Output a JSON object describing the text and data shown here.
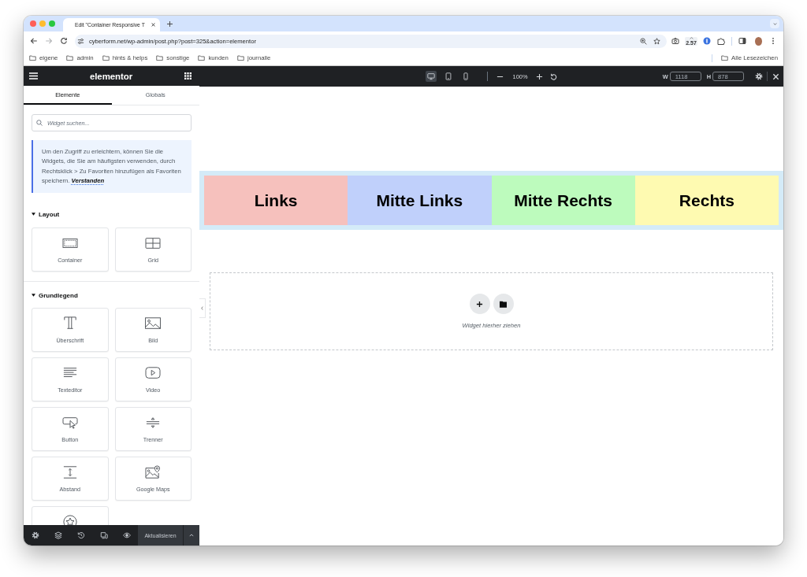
{
  "browser": {
    "tabs": [
      {
        "title": "Edit \"Container Responsive T",
        "selected": true
      }
    ],
    "nav": [
      {
        "kind": "back",
        "disabled": false
      },
      {
        "kind": "forward",
        "disabled": true
      },
      {
        "kind": "reload",
        "disabled": false
      }
    ],
    "url": "cyberform.net/wp-admin/post.php?post=325&action=elementor",
    "extension_badge": "2.57",
    "bookmarks": [
      {
        "label": "eigene"
      },
      {
        "label": "admin"
      },
      {
        "label": "hints & helps"
      },
      {
        "label": "sonstige"
      },
      {
        "label": "kunden"
      },
      {
        "label": "journalle"
      }
    ],
    "all_bookmarks": "Alle Lesezeichen"
  },
  "panel": {
    "logo": "elementor",
    "tabs": [
      {
        "label": "Elemente",
        "selected": true
      },
      {
        "label": "Globals",
        "selected": false
      }
    ],
    "search": {
      "placeholder": "Widget suchen..."
    },
    "notice": {
      "text": "Um den Zugriff zu erleichtern, können Sie die Widgets, die Sie am häufigsten verwenden, durch Rechtsklick > Zu Favoriten hinzufügen als Favoriten speichern.",
      "link": "Verstanden"
    },
    "categories": [
      {
        "title": "Layout",
        "expanded": true,
        "widgets": [
          {
            "kind": "container",
            "label": "Container"
          },
          {
            "kind": "grid",
            "label": "Grid"
          }
        ]
      },
      {
        "title": "Grundlegend",
        "expanded": true,
        "widgets": [
          {
            "kind": "heading",
            "label": "Überschrift"
          },
          {
            "kind": "image",
            "label": "Bild"
          },
          {
            "kind": "text-editor",
            "label": "Texteditor"
          },
          {
            "kind": "video",
            "label": "Video"
          },
          {
            "kind": "button",
            "label": "Button"
          },
          {
            "kind": "divider",
            "label": "Trenner"
          },
          {
            "kind": "spacer",
            "label": "Abstand"
          },
          {
            "kind": "map",
            "label": "Google Maps"
          },
          {
            "kind": "rating"
          }
        ]
      }
    ],
    "footer": {
      "update_button": "Aktualisieren"
    }
  },
  "preview": {
    "devices": [
      {
        "kind": "desktop",
        "selected": true
      },
      {
        "kind": "tablet",
        "selected": false
      },
      {
        "kind": "mobile",
        "selected": false
      }
    ],
    "zoom": "100%",
    "width": {
      "label": "W",
      "value": "1118"
    },
    "height": {
      "label": "H",
      "value": "878"
    },
    "columns": [
      {
        "heading": "Links",
        "color": "#f6c1bd"
      },
      {
        "heading": "Mitte Links",
        "color": "#c0d0fb"
      },
      {
        "heading": "Mitte Rechts",
        "color": "#bdfbbd"
      },
      {
        "heading": "Rechts",
        "color": "#fefab1"
      }
    ],
    "drop_zone": {
      "hint": "Widget hierher ziehen"
    }
  }
}
